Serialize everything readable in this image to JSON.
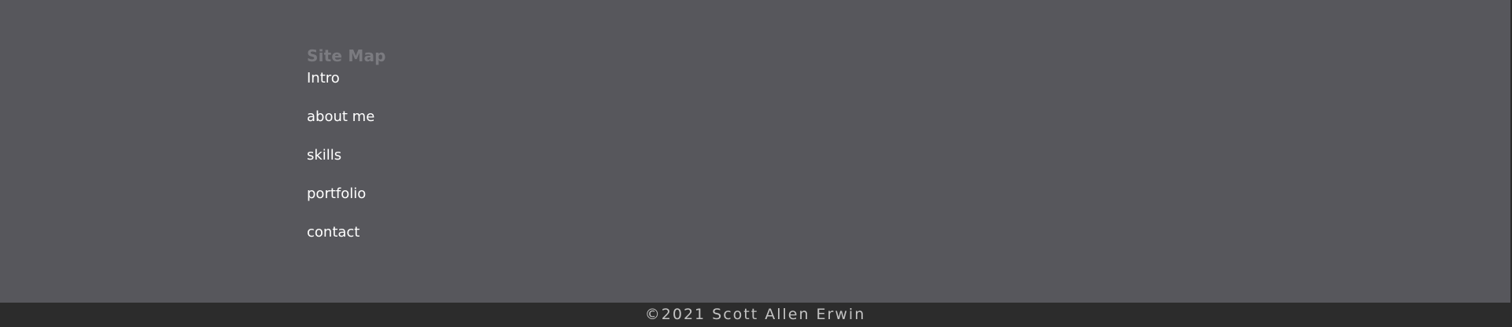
{
  "sitemap": {
    "title": "Site Map",
    "items": [
      {
        "label": "Intro"
      },
      {
        "label": "about me"
      },
      {
        "label": "skills"
      },
      {
        "label": "portfolio"
      },
      {
        "label": "contact"
      }
    ]
  },
  "footer": {
    "copyright": "©2021 Scott Allen Erwin"
  },
  "colors": {
    "background": "#57575c",
    "footer_bar": "#2c2c2c",
    "title": "#7b7b80",
    "link": "#ffffff",
    "copyright_text": "#c3c3c3"
  }
}
